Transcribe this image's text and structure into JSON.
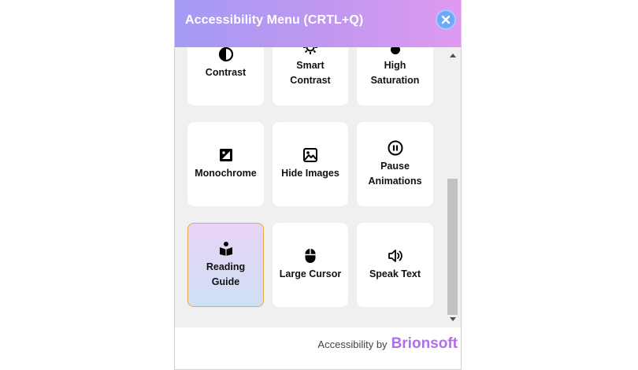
{
  "header": {
    "title": "Accessibility Menu (CRTL+Q)"
  },
  "tiles": [
    {
      "label": "Contrast",
      "icon": "contrast-icon"
    },
    {
      "label": "Smart Contrast",
      "icon": "smart-contrast-icon"
    },
    {
      "label": "High Saturation",
      "icon": "saturation-icon"
    },
    {
      "label": "Monochrome",
      "icon": "monochrome-icon"
    },
    {
      "label": "Hide Images",
      "icon": "image-icon"
    },
    {
      "label": "Pause Animations",
      "icon": "pause-icon"
    },
    {
      "label": "Reading Guide",
      "icon": "reading-guide-icon",
      "active": true
    },
    {
      "label": "Large Cursor",
      "icon": "mouse-icon"
    },
    {
      "label": "Speak Text",
      "icon": "speaker-icon"
    }
  ],
  "footer": {
    "prefix": "Accessibility by",
    "brand": "Brionsoft"
  },
  "colors": {
    "header_start": "#a49af4",
    "header_end": "#df9af0",
    "brand": "#b06fe6",
    "active_border": "#e8a94a"
  }
}
